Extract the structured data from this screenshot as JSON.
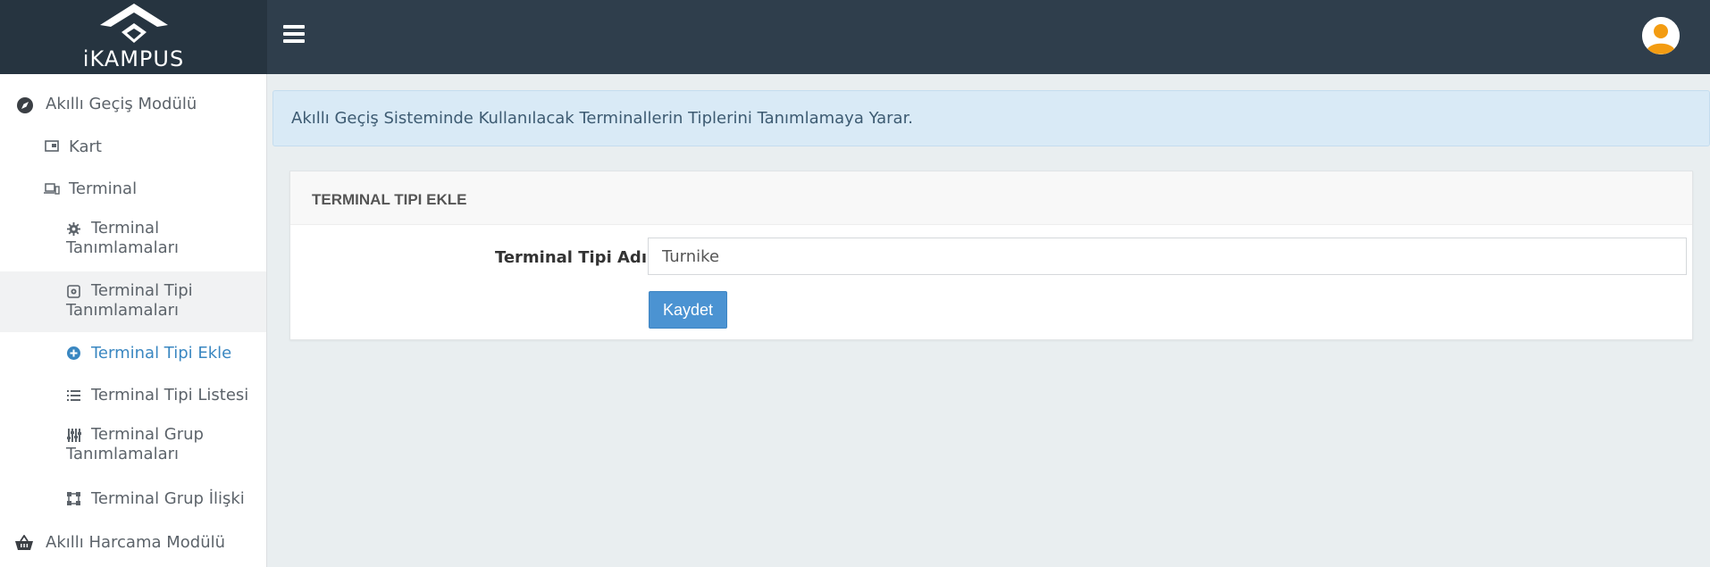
{
  "app": {
    "logo_text": "iKAMPUS"
  },
  "sidebar": {
    "items": [
      {
        "label": "Akıllı Geçiş Modülü",
        "icon": "compass-icon"
      },
      {
        "label": "Kart",
        "icon": "card-icon"
      },
      {
        "label": "Terminal",
        "icon": "devices-icon"
      },
      {
        "label": "Terminal Tanımlamaları",
        "icon": "gear-icon"
      },
      {
        "label": "Terminal Tipi Tanımlamaları",
        "icon": "settings-box-icon"
      },
      {
        "label": "Terminal Tipi Ekle",
        "icon": "plus-circle-icon"
      },
      {
        "label": "Terminal Tipi Listesi",
        "icon": "list-icon"
      },
      {
        "label": "Terminal Grup Tanımlamaları",
        "icon": "sliders-icon"
      },
      {
        "label": "Terminal Grup İlişki",
        "icon": "group-icon"
      },
      {
        "label": "Akıllı Harcama Modülü",
        "icon": "basket-icon"
      }
    ]
  },
  "info": {
    "text": "Akıllı Geçiş Sisteminde Kullanılacak Terminallerin Tiplerini Tanımlamaya Yarar."
  },
  "panel": {
    "title": "TERMINAL TIPI EKLE",
    "field_label": "Terminal Tipi Adı",
    "field_value": "Turnike",
    "save_label": "Kaydet"
  },
  "colors": {
    "topbar": "#2f3e4c",
    "accent": "#3a87c1",
    "button": "#4b93d2",
    "avatar": "#f39c12"
  }
}
